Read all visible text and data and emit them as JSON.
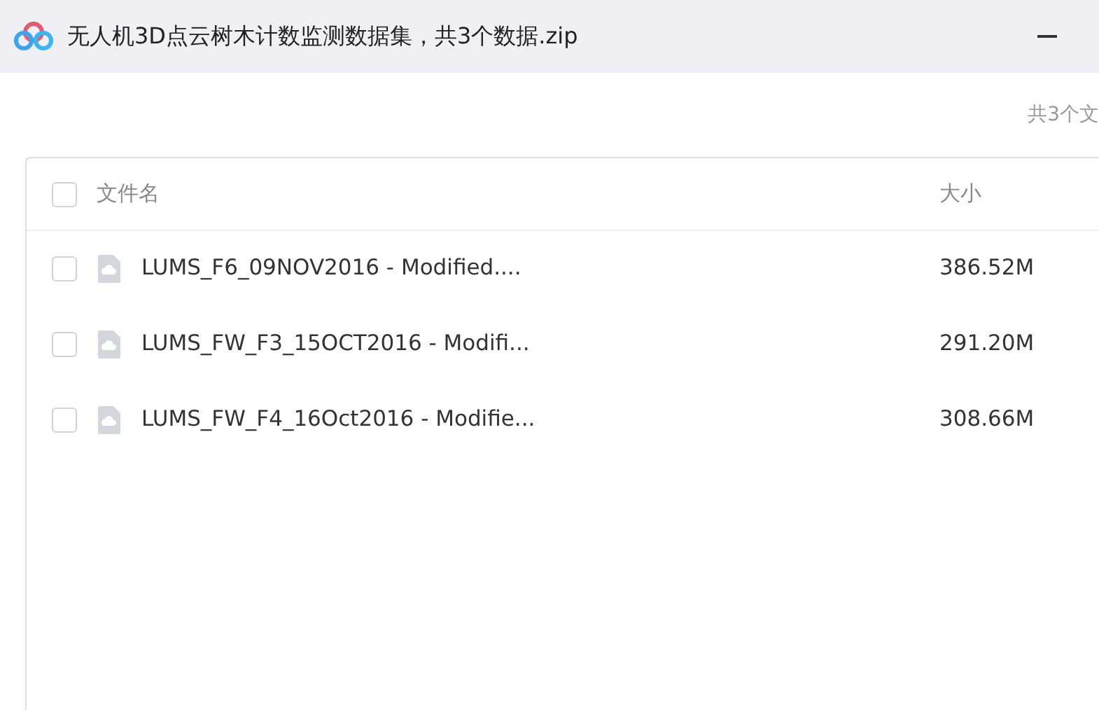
{
  "window": {
    "title": "无人机3D点云树木计数监测数据集，共3个数据.zip"
  },
  "summary": "共3个文",
  "table": {
    "select_all": {
      "checked": false
    },
    "columns": [
      "文件名",
      "大小"
    ],
    "rows": [
      {
        "name": "LUMS_F6_09NOV2016 - Modified....",
        "size": "386.52M",
        "checked": false
      },
      {
        "name": "LUMS_FW_F3_15OCT2016 - Modifi...",
        "size": "291.20M",
        "checked": false
      },
      {
        "name": "LUMS_FW_F4_16Oct2016 - Modifie...",
        "size": "308.66M",
        "checked": false
      }
    ]
  }
}
